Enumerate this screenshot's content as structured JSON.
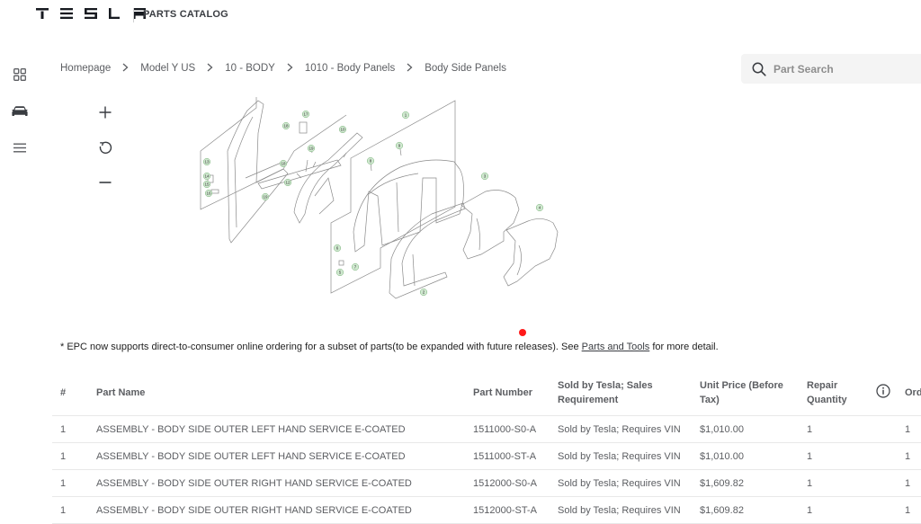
{
  "header": {
    "brand_letters": [
      "T",
      "E",
      "S",
      "L",
      "A"
    ],
    "catalog_title": "PARTS CATALOG"
  },
  "sidebar": {
    "items": [
      {
        "name": "grid",
        "icon": "grid-icon"
      },
      {
        "name": "vehicle",
        "icon": "car-icon"
      },
      {
        "name": "menu",
        "icon": "menu-icon"
      }
    ]
  },
  "breadcrumb": {
    "items": [
      "Homepage",
      "Model Y US",
      "10 - BODY",
      "1010 - Body Panels",
      "Body Side Panels"
    ],
    "separator": ">"
  },
  "search": {
    "placeholder": "Part Search",
    "value": ""
  },
  "diagram_controls": {
    "zoom_in": "plus-icon",
    "reset": "rotate-icon",
    "zoom_out": "minus-icon"
  },
  "diagram": {
    "callouts": [
      "1",
      "2",
      "3",
      "4",
      "5",
      "6",
      "7",
      "8",
      "9",
      "10",
      "12",
      "13",
      "14",
      "15",
      "16",
      "17",
      "18",
      "19"
    ],
    "callout_color": "#c8e6c9"
  },
  "notice": {
    "before": "* EPC now supports direct-to-consumer online ordering for a subset of parts(to be expanded with future releases). See ",
    "link": "Parts and Tools",
    "after": " for more detail."
  },
  "table": {
    "headers": {
      "num": "#",
      "name": "Part Name",
      "number": "Part Number",
      "sold": "Sold by Tesla; Sales Requirement",
      "price": "Unit Price (Before Tax)",
      "repair_qty": "Repair Quantity",
      "order_qty": "Order Quantity"
    },
    "rows": [
      {
        "num": "1",
        "name": "ASSEMBLY - BODY SIDE OUTER LEFT HAND SERVICE E-COATED",
        "number": "1511000-S0-A",
        "sold": "Sold by Tesla; Requires VIN",
        "price": "$1,010.00",
        "repair_qty": "1",
        "order_qty": "1"
      },
      {
        "num": "1",
        "name": "ASSEMBLY - BODY SIDE OUTER LEFT HAND SERVICE E-COATED",
        "number": "1511000-ST-A",
        "sold": "Sold by Tesla; Requires VIN",
        "price": "$1,010.00",
        "repair_qty": "1",
        "order_qty": "1"
      },
      {
        "num": "1",
        "name": "ASSEMBLY - BODY SIDE OUTER RIGHT HAND SERVICE E-COATED",
        "number": "1512000-S0-A",
        "sold": "Sold by Tesla; Requires VIN",
        "price": "$1,609.82",
        "repair_qty": "1",
        "order_qty": "1"
      },
      {
        "num": "1",
        "name": "ASSEMBLY - BODY SIDE OUTER RIGHT HAND SERVICE E-COATED",
        "number": "1512000-ST-A",
        "sold": "Sold by Tesla; Requires VIN",
        "price": "$1,609.82",
        "repair_qty": "1",
        "order_qty": "1"
      }
    ]
  },
  "colors": {
    "text_primary": "#393c41",
    "text_secondary": "#5c5e62",
    "search_bg": "#f4f4f4",
    "marker_red": "#ff1a1a"
  }
}
